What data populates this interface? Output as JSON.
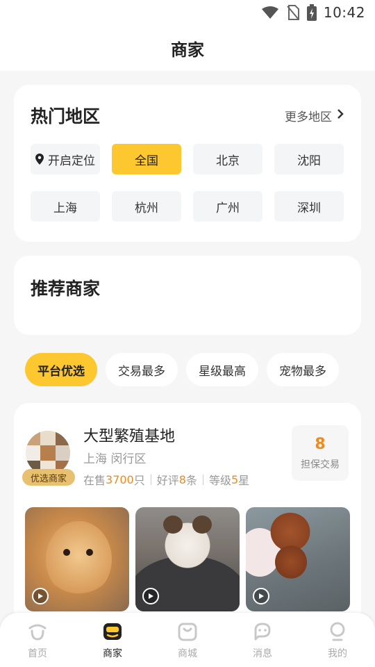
{
  "status_bar": {
    "time": "10:42"
  },
  "header": {
    "title": "商家"
  },
  "regions": {
    "title": "热门地区",
    "more_label": "更多地区",
    "locate_label": "开启定位",
    "items": [
      "全国",
      "北京",
      "沈阳",
      "上海",
      "杭州",
      "广州",
      "深圳"
    ],
    "selected": "全国"
  },
  "recommend": {
    "title": "推荐商家"
  },
  "filters": {
    "items": [
      "平台优选",
      "交易最多",
      "星级最高",
      "宠物最多"
    ],
    "selected": "平台优选"
  },
  "merchant": {
    "name": "大型繁殖基地",
    "location": "上海 闵行区",
    "badge": "优选商家",
    "on_sale_prefix": "在售 ",
    "on_sale_count": "3700",
    "on_sale_suffix": "只",
    "reviews_prefix": "好评",
    "reviews_count": "8",
    "reviews_suffix": "条",
    "level_prefix": "等级",
    "level_value": "5",
    "level_suffix": "星",
    "guarantee_count": "8",
    "guarantee_label": "担保交易"
  },
  "tabs": [
    {
      "label": "首页",
      "icon": "home-icon"
    },
    {
      "label": "商家",
      "icon": "shop-icon"
    },
    {
      "label": "商城",
      "icon": "bag-icon"
    },
    {
      "label": "消息",
      "icon": "chat-icon"
    },
    {
      "label": "我的",
      "icon": "profile-icon"
    }
  ],
  "active_tab": "商家",
  "colors": {
    "accent": "#fcc72f",
    "highlight": "#f08a1c",
    "badge": "#e7c070"
  }
}
